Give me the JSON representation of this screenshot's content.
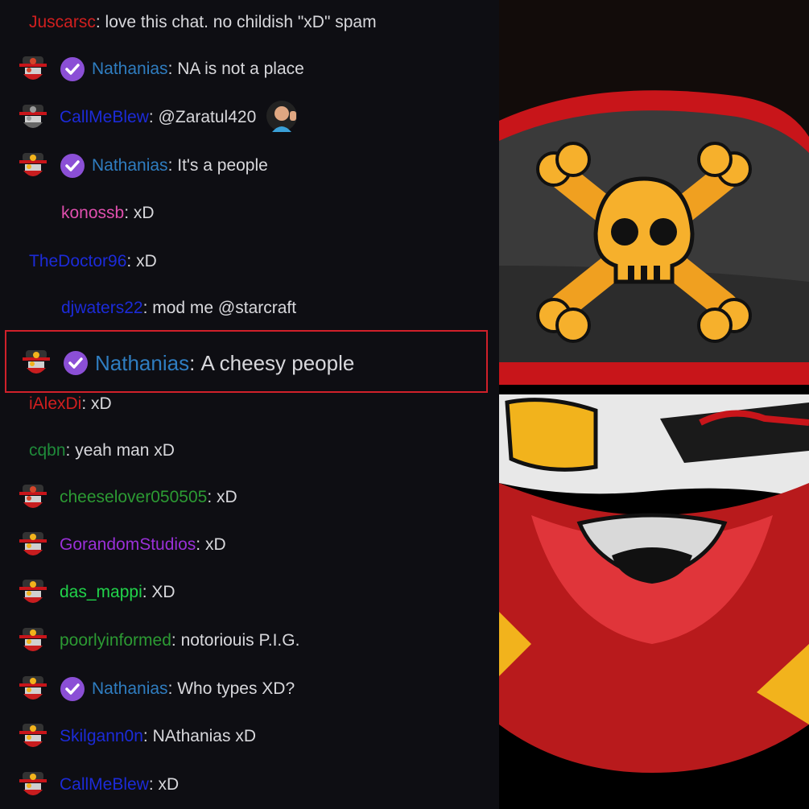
{
  "messages": [
    {
      "user": "Juscarsc",
      "color": "#d11f1f",
      "text": "love this chat. no childish \"xD\" spam",
      "avatar": "none",
      "badge": false
    },
    {
      "user": "Nathanias",
      "color": "#2f7dc0",
      "text": "NA is not a place",
      "avatar": "pirate-red",
      "badge": true
    },
    {
      "user": "CallMeBlew",
      "color": "#1c2bd8",
      "text": "@Zaratul420",
      "avatar": "pirate-gray",
      "badge": false,
      "emote": "waving-woman-emote"
    },
    {
      "user": "Nathanias",
      "color": "#2f7dc0",
      "text": "It's a people",
      "avatar": "pirate-yellow",
      "badge": true
    },
    {
      "user": "konossb",
      "color": "#e04fae",
      "text": "xD",
      "avatar": "none",
      "badge": false,
      "indent": true
    },
    {
      "user": "TheDoctor96",
      "color": "#1c2bd8",
      "text": "xD",
      "avatar": "none",
      "badge": false
    },
    {
      "user": "djwaters22",
      "color": "#1c2bd8",
      "text": "mod me @starcraft",
      "avatar": "none",
      "badge": false,
      "indent": true
    },
    {
      "user": "iAlexDi",
      "color": "#d11f1f",
      "text": "xD",
      "avatar": "none",
      "badge": false
    },
    {
      "user": "cqbn",
      "color": "#1f8a3a",
      "text": "yeah man xD",
      "avatar": "none",
      "badge": false
    },
    {
      "user": "cheeselover050505",
      "color": "#2c9a33",
      "text": "xD",
      "avatar": "pirate-red",
      "badge": false
    },
    {
      "user": "GorandomStudios",
      "color": "#9a30d8",
      "text": "xD",
      "avatar": "pirate-yellow",
      "badge": false
    },
    {
      "user": "das_mappi",
      "color": "#21d34a",
      "text": "XD",
      "avatar": "pirate-yellow",
      "badge": false
    },
    {
      "user": "poorlyinformed",
      "color": "#2c9a33",
      "text": "notoriouis P.I.G.",
      "avatar": "pirate-yellow",
      "badge": false
    },
    {
      "user": "Nathanias",
      "color": "#2f7dc0",
      "text": "Who types XD?",
      "avatar": "pirate-yellow",
      "badge": true
    },
    {
      "user": "Skilgann0n",
      "color": "#1c2bd8",
      "text": "NAthanias xD",
      "avatar": "pirate-yellow",
      "badge": false
    },
    {
      "user": "CallMeBlew",
      "color": "#1c2bd8",
      "text": "xD",
      "avatar": "pirate-yellow",
      "badge": false
    }
  ],
  "highlighted": {
    "user": "Nathanias",
    "color": "#2f7dc0",
    "text": "A cheesy people",
    "avatar": "pirate-yellow",
    "badge": true
  },
  "colors": {
    "badge": "#8b4fd6",
    "highlight_border": "#d0202a",
    "chat_bg": "#0e0e13"
  },
  "mascot": {
    "icon": "pirate-skull-mascot"
  }
}
